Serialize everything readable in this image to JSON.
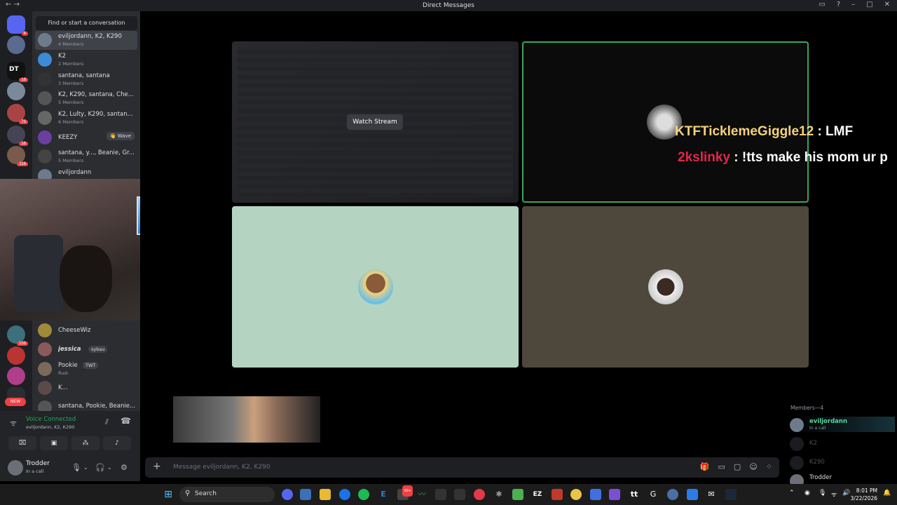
{
  "titlebar": {
    "title": "Direct Messages",
    "nav_back": "←",
    "nav_fwd": "→"
  },
  "sidebar": {
    "find_label": "Find or start a conversation",
    "dms": [
      {
        "name": "eviljordann, K2, K290",
        "sub": "4 Members"
      },
      {
        "name": "K2",
        "sub": "2 Members"
      },
      {
        "name": "santana, santana",
        "sub": "3 Members"
      },
      {
        "name": "K2, K290, santana, Che...",
        "sub": "5 Members"
      },
      {
        "name": "K2, Lulty, K290, santan...",
        "sub": "6 Members"
      },
      {
        "name": "KEEZY",
        "sub": "",
        "action": "👋 Wave"
      },
      {
        "name": "santana, y..., Beanie, Gr...",
        "sub": "5 Members"
      },
      {
        "name": "eviljordann",
        "sub": ""
      },
      {
        "name": "CheeseWiz",
        "sub": ""
      },
      {
        "name": "jessica",
        "sub": "",
        "tag": "sybau"
      },
      {
        "name": "Pookie",
        "sub": "Rust",
        "tag": "TWT"
      },
      {
        "name": "K...",
        "sub": ""
      },
      {
        "name": "santana, Pookie, Beanie...",
        "sub": ""
      }
    ],
    "guild_badges": [
      "4",
      "18",
      "75",
      "16",
      "116",
      "109"
    ],
    "guild_initials": [
      "DT",
      "NEW"
    ]
  },
  "voice": {
    "status": "Voice Connected",
    "channel": "eviljordann, K2, K290"
  },
  "user": {
    "name": "Trodder",
    "status": "In a call"
  },
  "stage": {
    "watch_label": "Watch Stream",
    "chat1_user": "KTFTicklemeGiggle12",
    "chat1_text": ": LMF",
    "chat2_user": "2kslinky",
    "chat2_text": ": !tts make his mom ur p"
  },
  "members": {
    "header": "Members—4",
    "list": [
      {
        "name": "eviljordann",
        "status": "In a call",
        "dim": false
      },
      {
        "name": "K2",
        "status": "",
        "dim": true
      },
      {
        "name": "K290",
        "status": "",
        "dim": true
      },
      {
        "name": "Trodder",
        "status": "",
        "dim": false
      }
    ]
  },
  "composer": {
    "placeholder": "Message eviljordann, K2, K290",
    "plus": "+"
  },
  "taskbar": {
    "search_label": "Search",
    "time": "8:01 PM",
    "date": "3/22/2026",
    "badge": "99+"
  },
  "colors": {
    "accent": "#5865f2",
    "green": "#23a55a",
    "red": "#f23f43",
    "speaking": "#3ba55c"
  }
}
